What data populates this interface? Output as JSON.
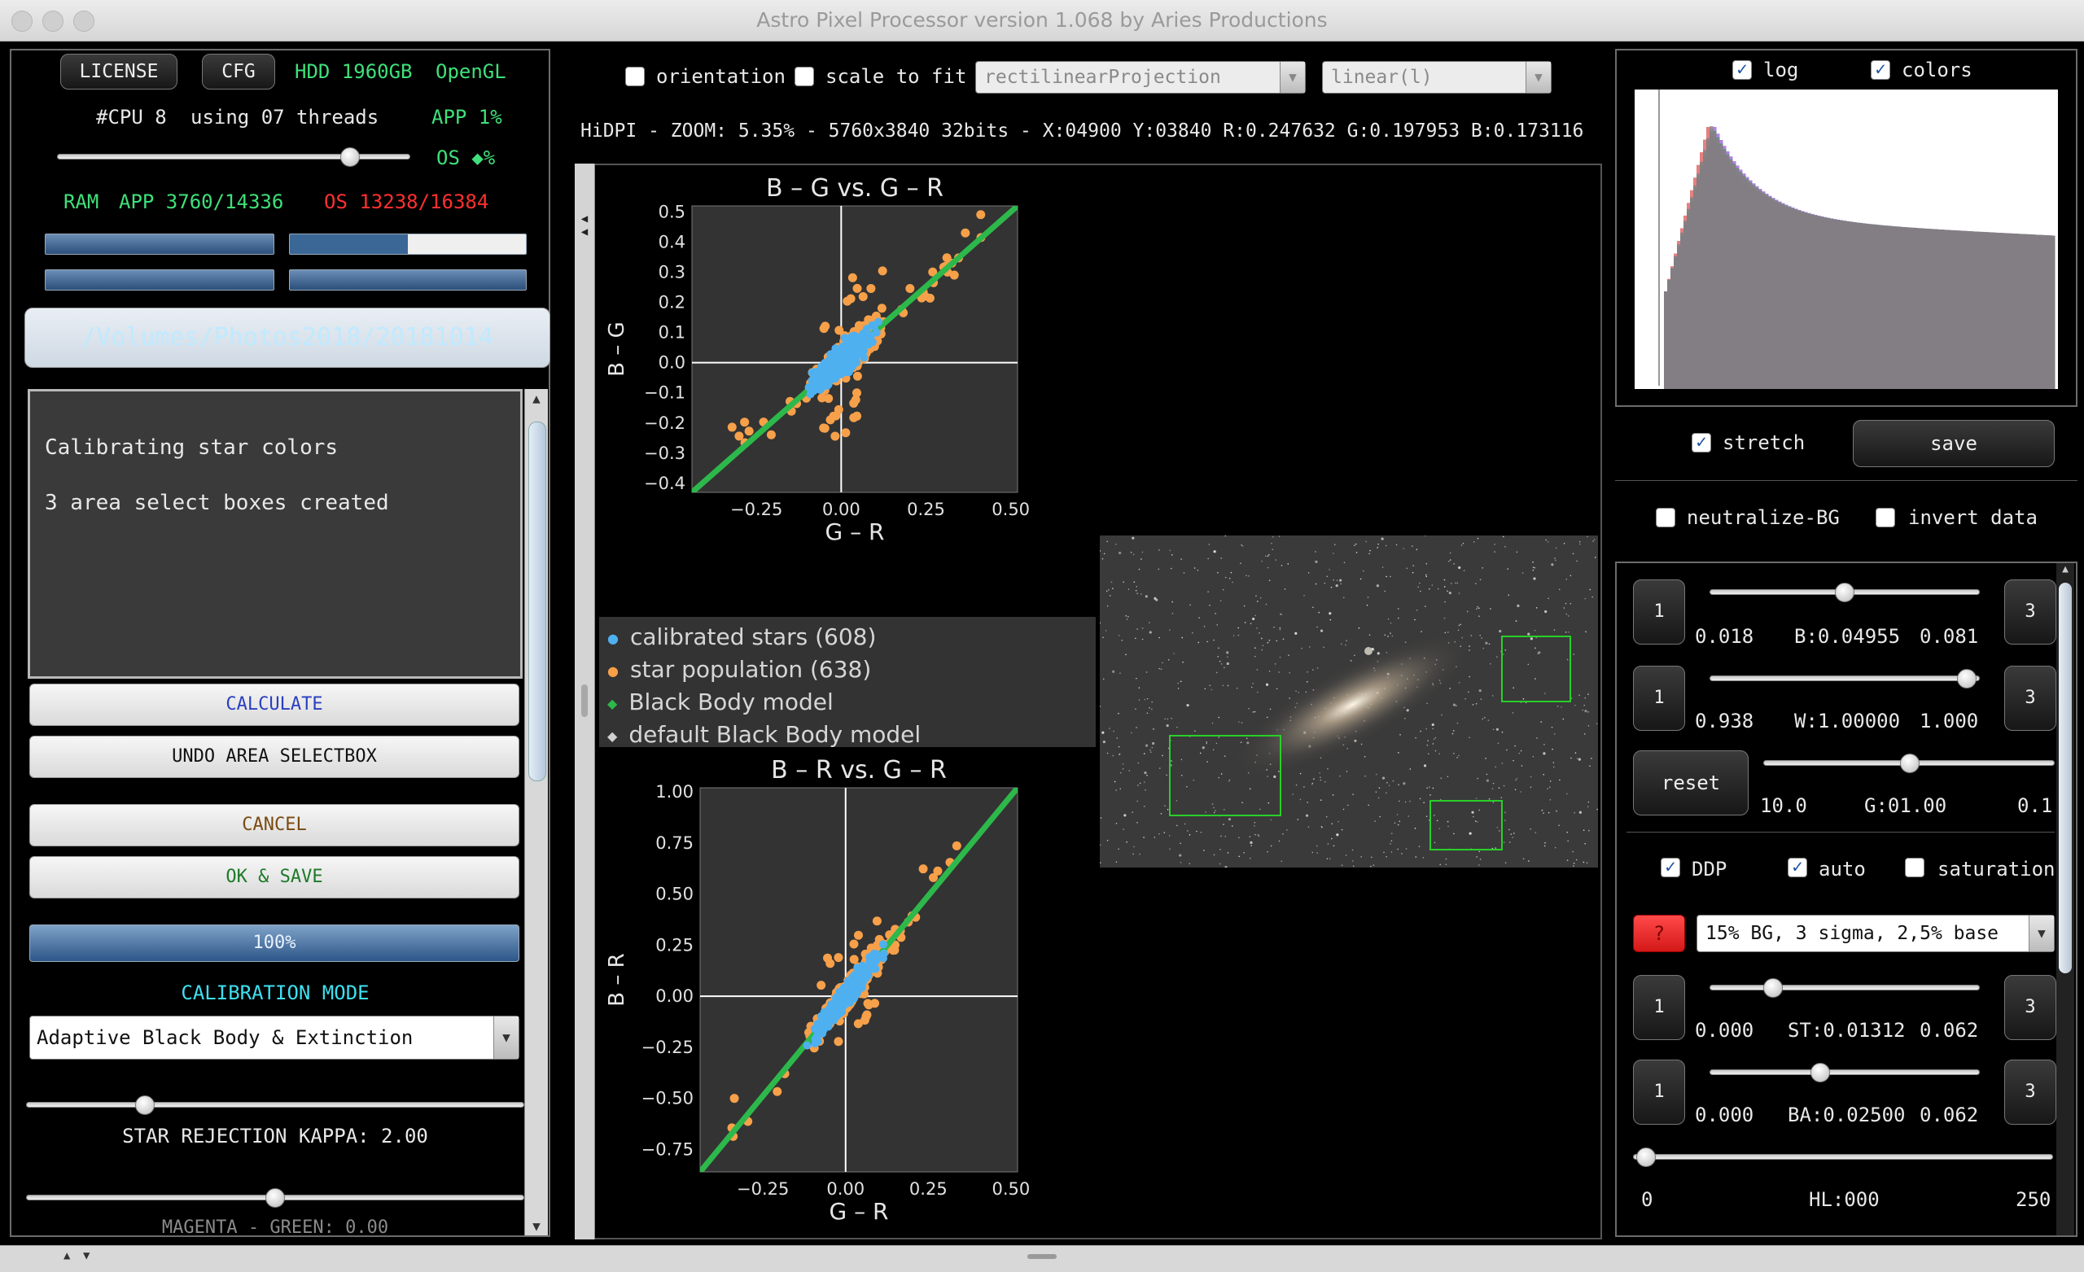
{
  "window": {
    "title": "Astro Pixel Processor version 1.068 by Aries Productions"
  },
  "left": {
    "license_label": "LICENSE",
    "cfg_label": "CFG",
    "hdd": "HDD 1960GB",
    "opengl": "OpenGL",
    "cpu": "#CPU 8",
    "threads": "using 07 threads",
    "app_cpu": "APP 1%",
    "os_cpu": "OS ◆%",
    "ram_label": "RAM",
    "ram_app": "APP 3760/14336",
    "ram_os": "OS 13238/16384",
    "path": "/Volumes/Photos2018/20181014",
    "console_lines": [
      "Calibrating star colors",
      "3 area select boxes created"
    ],
    "calculate": "CALCULATE",
    "undo": "UNDO AREA SELECTBOX",
    "cancel": "CANCEL",
    "ok_save": "OK & SAVE",
    "progress": "100%",
    "calibration_mode_label": "CALIBRATION MODE",
    "calibration_mode_value": "Adaptive Black Body & Extinction",
    "kappa_label": "STAR REJECTION KAPPA: 2.00",
    "magenta_label": "MAGENTA - GREEN: 0.00"
  },
  "toolbar": {
    "orientation": "orientation",
    "scale_to_fit": "scale to fit",
    "projection": "rectilinearProjection",
    "stretch_mode": "linear(l)",
    "info": "HiDPI - ZOOM: 5.35% - 5760x3840 32bits - X:04900 Y:03840 R:0.247632 G:0.197953 B:0.173116"
  },
  "chart_data": [
    {
      "type": "scatter",
      "title": "B – G  vs.  G – R",
      "xlabel": "G – R",
      "ylabel": "B – G",
      "xlim": [
        -0.44,
        0.52
      ],
      "ylim": [
        -0.43,
        0.52
      ],
      "xticks": [
        "−0.25",
        "0.00",
        "0.25",
        "0.50"
      ],
      "yticks": [
        "0.5",
        "0.4",
        "0.3",
        "0.2",
        "0.1",
        "0.0",
        "−0.1",
        "−0.2",
        "−0.3",
        "−0.4"
      ],
      "model_line": {
        "x": [
          -0.44,
          0.52
        ],
        "y": [
          -0.43,
          0.52
        ]
      },
      "colors": {
        "calibrated": "#4fb0f0",
        "population": "#f7a04a",
        "model": "#2db84b"
      }
    },
    {
      "type": "scatter",
      "title": "B – R  vs.  G – R",
      "xlabel": "G – R",
      "ylabel": "B – R",
      "xlim": [
        -0.44,
        0.52
      ],
      "ylim": [
        -0.86,
        1.02
      ],
      "xticks": [
        "−0.25",
        "0.00",
        "0.25",
        "0.50"
      ],
      "yticks": [
        "1.00",
        "0.75",
        "0.50",
        "0.25",
        "0.00",
        "−0.25",
        "−0.50",
        "−0.75"
      ],
      "model_line": {
        "x": [
          -0.44,
          0.52
        ],
        "y": [
          -0.86,
          1.02
        ]
      }
    }
  ],
  "legend": [
    {
      "label": "calibrated stars (608)",
      "color": "#4fb0f0",
      "marker": "●"
    },
    {
      "label": "star population (638)",
      "color": "#f7a04a",
      "marker": "●"
    },
    {
      "label": "Black Body model",
      "color": "#2db84b",
      "marker": "◆"
    },
    {
      "label": "default Black Body model",
      "color": "#d0d0d0",
      "marker": "◆"
    }
  ],
  "right": {
    "log": "log",
    "colors": "colors",
    "stretch": "stretch",
    "save": "save",
    "neutralize": "neutralize-BG",
    "invert": "invert data",
    "btn1": "1",
    "btn3": "3",
    "b_min": "0.018",
    "b_val": "B:0.04955",
    "b_max": "0.081",
    "w_min": "0.938",
    "w_val": "W:1.00000",
    "w_max": "1.000",
    "reset": "reset",
    "g_min": "10.0",
    "g_val": "G:01.00",
    "g_max": "0.1",
    "ddp": "DDP",
    "auto": "auto",
    "saturation": "saturation",
    "help": "?",
    "preset": "15% BG, 3 sigma, 2,5% base",
    "st_min": "0.000",
    "st_val": "ST:0.01312",
    "st_max": "0.062",
    "ba_min": "0.000",
    "ba_val": "BA:0.02500",
    "ba_max": "0.062",
    "hl_min": "0",
    "hl_val": "HL:000",
    "hl_max": "250"
  }
}
